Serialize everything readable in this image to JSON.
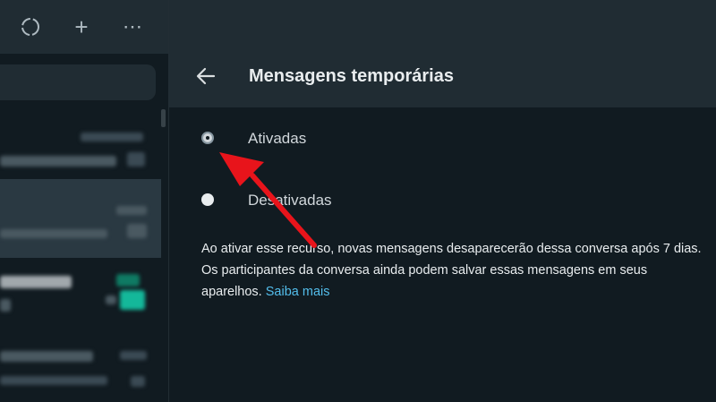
{
  "left_pane": {
    "header_icons": [
      {
        "name": "status-icon"
      },
      {
        "name": "new-chat-icon",
        "glyph": "+"
      },
      {
        "name": "menu-icon",
        "glyph": "⋯"
      }
    ]
  },
  "panel": {
    "title": "Mensagens temporárias",
    "back_icon": "arrow-left-icon",
    "options": [
      {
        "label": "Ativadas",
        "checked": true
      },
      {
        "label": "Desativadas",
        "checked": false
      }
    ],
    "description": "Ao ativar esse recurso, novas mensagens desaparecerão dessa conversa após 7 dias. Os participantes da conversa ainda podem salvar essas mensagens em seus aparelhos.",
    "learn_more": "Saiba mais"
  },
  "colors": {
    "background": "#111b21",
    "header": "#202c33",
    "link": "#53bdeb",
    "annotation_arrow": "#e8141b"
  }
}
